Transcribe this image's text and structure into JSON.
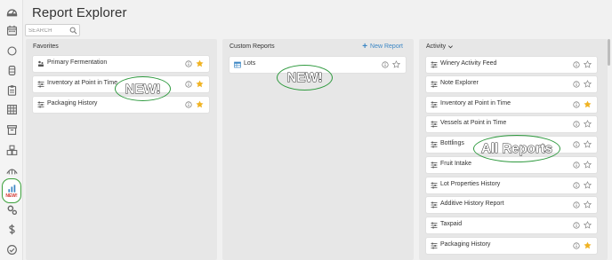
{
  "page": {
    "title": "Report Explorer"
  },
  "search": {
    "placeholder": "SEARCH"
  },
  "rail": {
    "new_badge": "NEW!",
    "icons": [
      "dashboard-icon",
      "calendar-icon",
      "circle-icon",
      "barrel-icon",
      "clipboard-icon",
      "grid-icon",
      "archive-icon",
      "boxes-icon",
      "vineyard-icon",
      "reports-icon",
      "settings-icon",
      "dollar-icon",
      "check-circle-icon"
    ]
  },
  "favorites": {
    "title": "Favorites",
    "items": [
      {
        "label": "Primary Fermentation",
        "icon": "fermentation-icon",
        "starred": true
      },
      {
        "label": "Inventory at Point in Time",
        "icon": "sliders-icon",
        "starred": true
      },
      {
        "label": "Packaging History",
        "icon": "sliders-icon",
        "starred": true
      }
    ],
    "stamp": "NEW!"
  },
  "custom": {
    "title": "Custom Reports",
    "new_report": "New Report",
    "items": [
      {
        "label": "Lots",
        "icon": "table-icon",
        "starred": false
      }
    ],
    "stamp": "NEW!"
  },
  "activity": {
    "title": "Activity",
    "items": [
      {
        "label": "Winery Activity Feed",
        "icon": "sliders-icon",
        "starred": false
      },
      {
        "label": "Note Explorer",
        "icon": "sliders-icon",
        "starred": false
      },
      {
        "label": "Inventory at Point in Time",
        "icon": "sliders-icon",
        "starred": true
      },
      {
        "label": "Vessels at Point in Time",
        "icon": "sliders-icon",
        "starred": false
      },
      {
        "label": "Bottlings",
        "icon": "sliders-icon",
        "starred": false
      },
      {
        "label": "Fruit Intake",
        "icon": "sliders-icon",
        "starred": false
      },
      {
        "label": "Lot Properties History",
        "icon": "sliders-icon",
        "starred": false
      },
      {
        "label": "Additive History Report",
        "icon": "sliders-icon",
        "starred": false
      },
      {
        "label": "Taxpaid",
        "icon": "sliders-icon",
        "starred": false
      },
      {
        "label": "Packaging History",
        "icon": "sliders-icon",
        "starred": true
      }
    ],
    "stamp": "All Reports"
  },
  "colors": {
    "accent": "#3b86c4",
    "star": "#f0b323",
    "stamp_ring": "#2f9a3f",
    "badge": "#d0312d"
  }
}
